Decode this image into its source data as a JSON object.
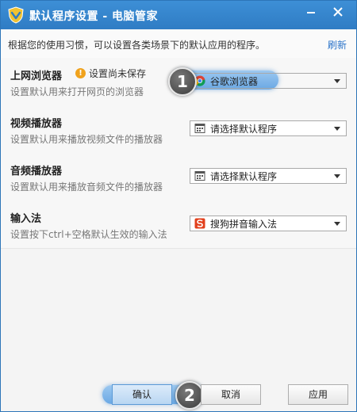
{
  "window": {
    "title": "默认程序设置 - 电脑管家",
    "minimize_label": "—",
    "close_label": "✕"
  },
  "hint": {
    "text": "根据您的使用习惯，可以设置各类场景下的默认应用的程序。",
    "refresh_label": "刷新"
  },
  "rows": [
    {
      "title": "上网浏览器",
      "desc": "设置默认用来打开网页的浏览器",
      "warning": "设置尚未保存",
      "selected": "谷歌浏览器",
      "icon": "chrome-icon"
    },
    {
      "title": "视频播放器",
      "desc": "设置默认用来播放视频文件的播放器",
      "selected": "请选择默认程序",
      "icon": "program-icon"
    },
    {
      "title": "音频播放器",
      "desc": "设置默认用来播放音频文件的播放器",
      "selected": "请选择默认程序",
      "icon": "program-icon"
    },
    {
      "title": "输入法",
      "desc": "设置按下ctrl+空格默认生效的输入法",
      "selected": "搜狗拼音输入法",
      "icon": "sogou-icon"
    }
  ],
  "callouts": [
    "1",
    "2"
  ],
  "buttons": {
    "confirm": "确认",
    "cancel": "取消",
    "apply": "应用"
  },
  "colors": {
    "titlebar": "#2f7cc4",
    "link": "#2a73c9",
    "warning": "#f0a21c",
    "sogou": "#e2401c"
  }
}
